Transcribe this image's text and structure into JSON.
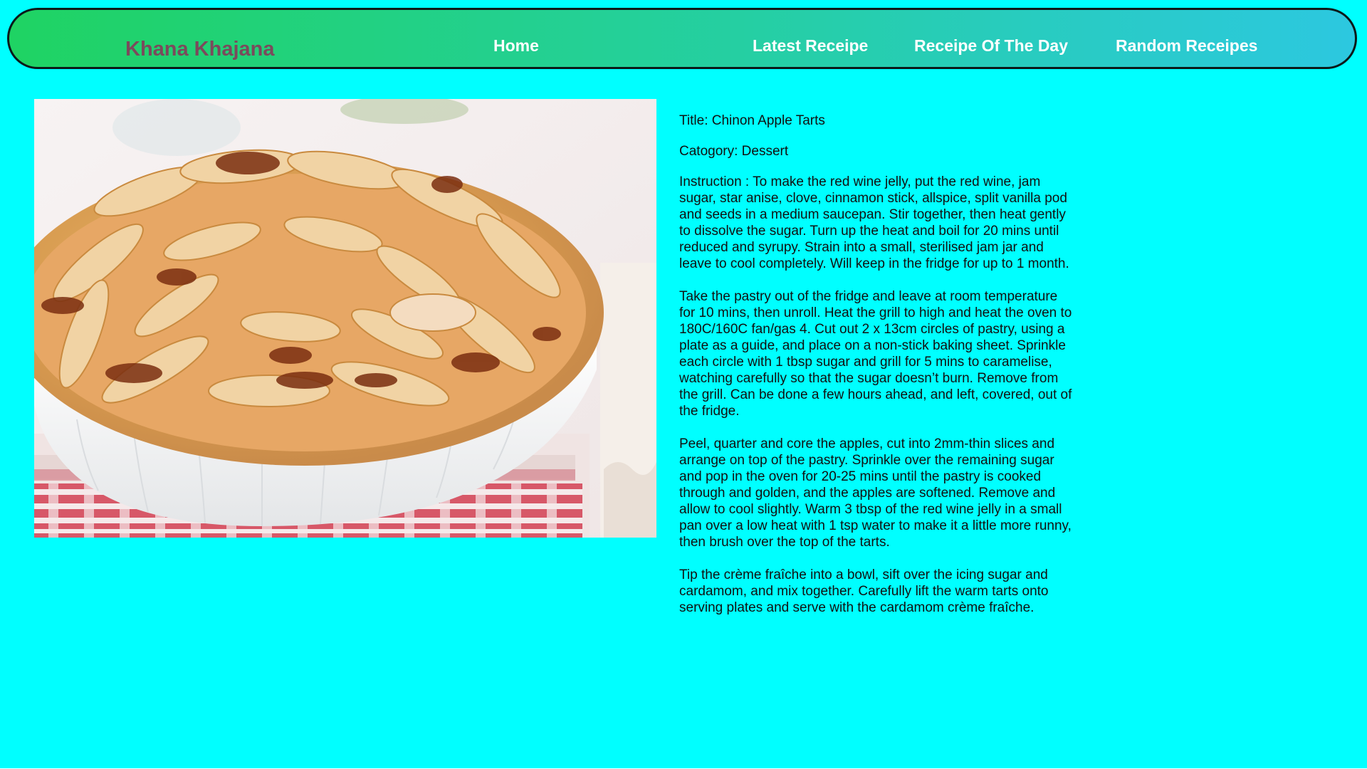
{
  "navbar": {
    "brand": "Khana Khajana",
    "links": {
      "home": "Home",
      "latest": "Latest Receipe",
      "of_the_day": "Receipe Of The Day",
      "random": "Random Receipes"
    }
  },
  "recipe": {
    "title": "Title: Chinon Apple Tarts",
    "category": "Catogory: Dessert",
    "instructions": [
      "Instruction : To make the red wine jelly, put the red wine, jam sugar, star anise, clove, cinnamon stick, allspice, split vanilla pod and seeds in a medium saucepan. Stir together, then heat gently to dissolve the sugar. Turn up the heat and boil for 20 mins until reduced and syrupy. Strain into a small, sterilised jam jar and leave to cool completely. Will keep in the fridge for up to 1 month.",
      "Take the pastry out of the fridge and leave at room temperature for 10 mins, then unroll. Heat the grill to high and heat the oven to 180C/160C fan/gas 4. Cut out 2 x 13cm circles of pastry, using a plate as a guide, and place on a non-stick baking sheet. Sprinkle each circle with 1 tbsp sugar and grill for 5 mins to caramelise, watching carefully so that the sugar doesn’t burn. Remove from the grill. Can be done a few hours ahead, and left, covered, out of the fridge.",
      "Peel, quarter and core the apples, cut into 2mm-thin slices and arrange on top of the pastry. Sprinkle over the remaining sugar and pop in the oven for 20-25 mins until the pastry is cooked through and golden, and the apples are softened. Remove and allow to cool slightly. Warm 3 tbsp of the red wine jelly in a small pan over a low heat with 1 tsp water to make it a little more runny, then brush over the top of the tarts.",
      "Tip the crème fraîche into a bowl, sift over the icing sugar and cardamom, and mix together. Carefully lift the warm tarts onto serving plates and serve with the cardamom crème fraîche."
    ]
  },
  "colors": {
    "page_background": "#00ffff",
    "navbar_gradient_start": "#1fd363",
    "navbar_gradient_end": "#2cc8e0",
    "brand_text": "#7b4a5c",
    "nav_link_text": "#ffffff"
  }
}
